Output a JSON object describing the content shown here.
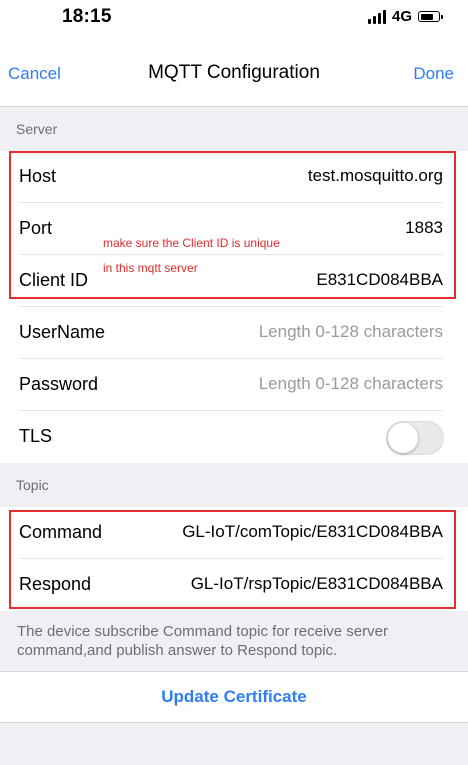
{
  "status_bar": {
    "time": "18:15",
    "network": "4G",
    "icons": [
      "signal-icon",
      "battery-icon"
    ]
  },
  "nav": {
    "cancel": "Cancel",
    "title": "MQTT Configuration",
    "done": "Done"
  },
  "server": {
    "header": "Server",
    "host": {
      "label": "Host",
      "value": "test.mosquitto.org"
    },
    "port": {
      "label": "Port",
      "value": "1883"
    },
    "client_id": {
      "label": "Client ID",
      "value": "E831CD084BBA"
    },
    "username": {
      "label": "UserName",
      "placeholder": "Length 0-128 characters"
    },
    "password": {
      "label": "Password",
      "placeholder": "Length 0-128 characters"
    },
    "tls": {
      "label": "TLS",
      "enabled": false
    },
    "annotation_line1": "make sure the Client ID is unique",
    "annotation_line2": "in this mqtt server"
  },
  "topic": {
    "header": "Topic",
    "command": {
      "label": "Command",
      "value": "GL-IoT/comTopic/E831CD084BBA"
    },
    "respond": {
      "label": "Respond",
      "value": "GL-IoT/rspTopic/E831CD084BBA"
    },
    "footnote": "The device subscribe Command topic for receive server command,and publish answer to Respond topic."
  },
  "update_certificate": "Update Certificate",
  "colors": {
    "accent": "#2f7cf6",
    "annotation": "#e02f2f",
    "background": "#efeff4"
  }
}
